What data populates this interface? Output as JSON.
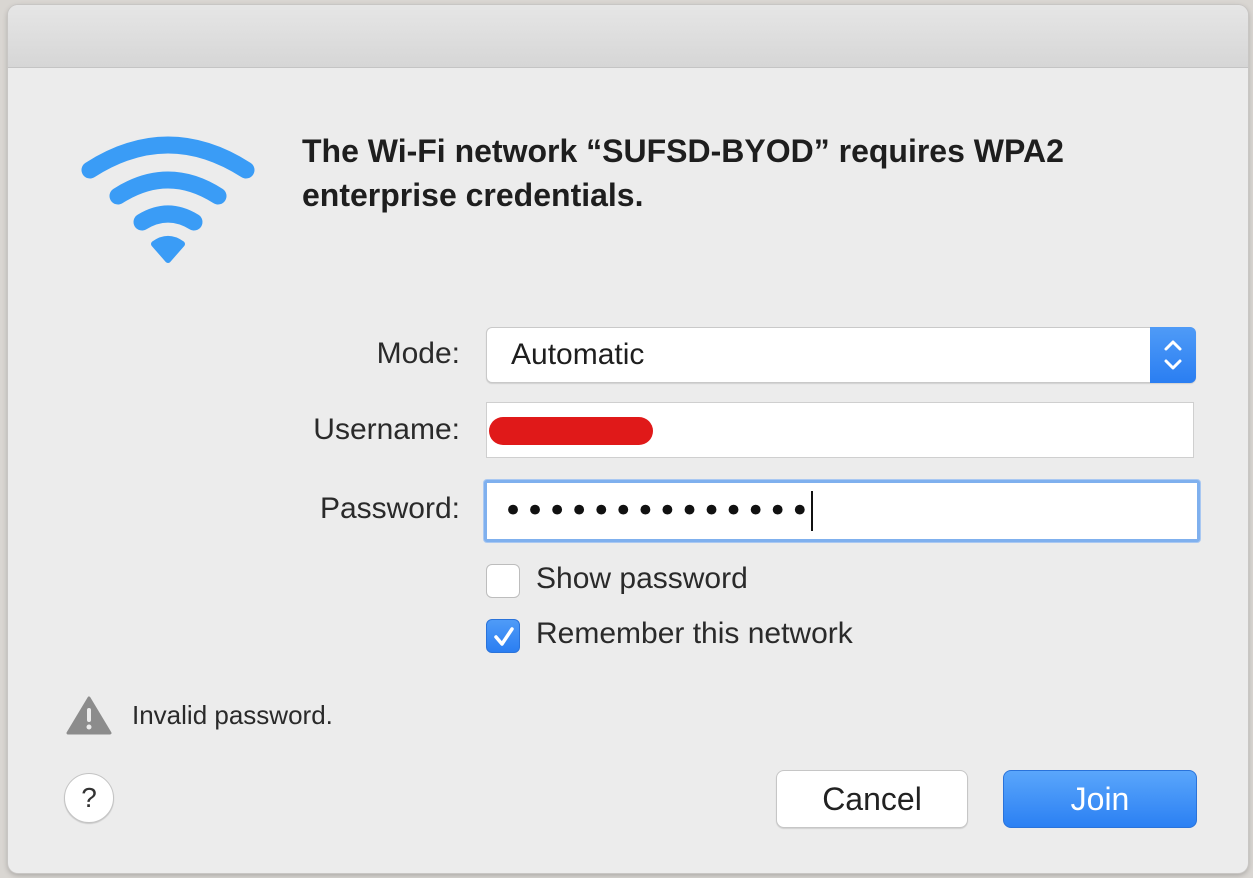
{
  "dialog": {
    "headline": "The Wi-Fi network “SUFSD-BYOD” requires WPA2 enterprise credentials."
  },
  "form": {
    "mode_label": "Mode:",
    "mode_value": "Automatic",
    "username_label": "Username:",
    "username_value": "",
    "password_label": "Password:",
    "password_masked": "••••••••••••••",
    "show_password_label": "Show password",
    "show_password_checked": false,
    "remember_label": "Remember this network",
    "remember_checked": true
  },
  "status": {
    "warning_text": "Invalid password."
  },
  "buttons": {
    "help_label": "?",
    "cancel_label": "Cancel",
    "join_label": "Join"
  },
  "icons": {
    "wifi": "wifi-icon",
    "warning": "warning-triangle-icon",
    "stepper": "chevron-updown-icon",
    "checkmark": "checkmark-icon"
  },
  "colors": {
    "accent": "#2b80f3",
    "wifi_blue": "#3a9cf6",
    "redaction": "#e01919"
  }
}
